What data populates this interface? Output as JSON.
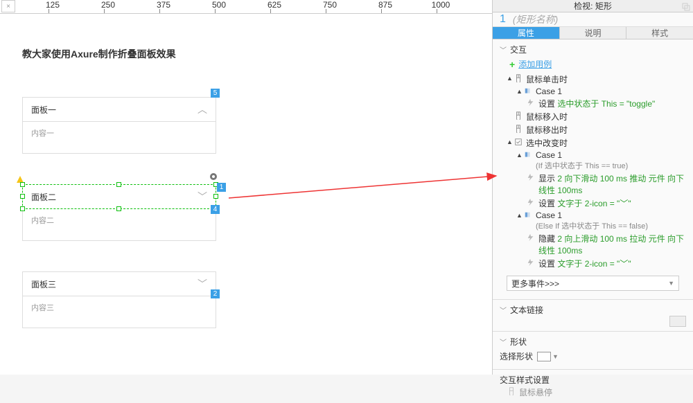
{
  "ruler": {
    "ticks": [
      125,
      250,
      375,
      500,
      625,
      750,
      875,
      1000
    ]
  },
  "tab_close": "×",
  "canvas": {
    "heading": "教大家使用Axure制作折叠面板效果",
    "panels": [
      {
        "title": "面板一",
        "content": "内容一",
        "chev": "︿",
        "selected": false
      },
      {
        "title": "面板二",
        "content": "内容二",
        "chev": "﹀",
        "selected": true
      },
      {
        "title": "面板三",
        "content": "内容三",
        "chev": "﹀",
        "selected": false
      }
    ],
    "badges": {
      "b5": "5",
      "b1": "1",
      "b4": "4",
      "b2": "2"
    }
  },
  "inspector": {
    "title": "检视: 矩形",
    "index": "1",
    "name_placeholder": "(矩形名称)",
    "tabs": {
      "props": "属性",
      "notes": "说明",
      "style": "样式"
    },
    "sections": {
      "interaction": "交互",
      "add_case": "添加用例",
      "events": {
        "click": "鼠标单击时",
        "mousein": "鼠标移入时",
        "mouseout": "鼠标移出时",
        "selchange": "选中改变时"
      },
      "case1_label": "Case 1",
      "click_action": {
        "prefix": "设置",
        "link": "选中状态于 This = \"toggle\""
      },
      "sel_true_cond": "(If 选中状态于 This == true)",
      "sel_true_a1": {
        "prefix": "显示",
        "link": "2 向下滑动 100 ms 推动 元件 向下 线性 100ms"
      },
      "sel_true_a2": {
        "prefix": "设置",
        "link": "文字于 2-icon = \"﹀\""
      },
      "sel_false_cond": "(Else If 选中状态于 This == false)",
      "sel_false_a1": {
        "prefix": "隐藏",
        "link": "2 向上滑动 100 ms 拉动 元件 向下 线性 100ms"
      },
      "sel_false_a2": {
        "prefix": "设置",
        "link": "文字于 2-icon = \"﹀\""
      },
      "more_events": "更多事件>>>",
      "text_link": "文本链接",
      "shape": "形状",
      "select_shape": "选择形状",
      "ix_style": "交互样式设置",
      "ix_style_item": "鼠标悬停"
    }
  }
}
